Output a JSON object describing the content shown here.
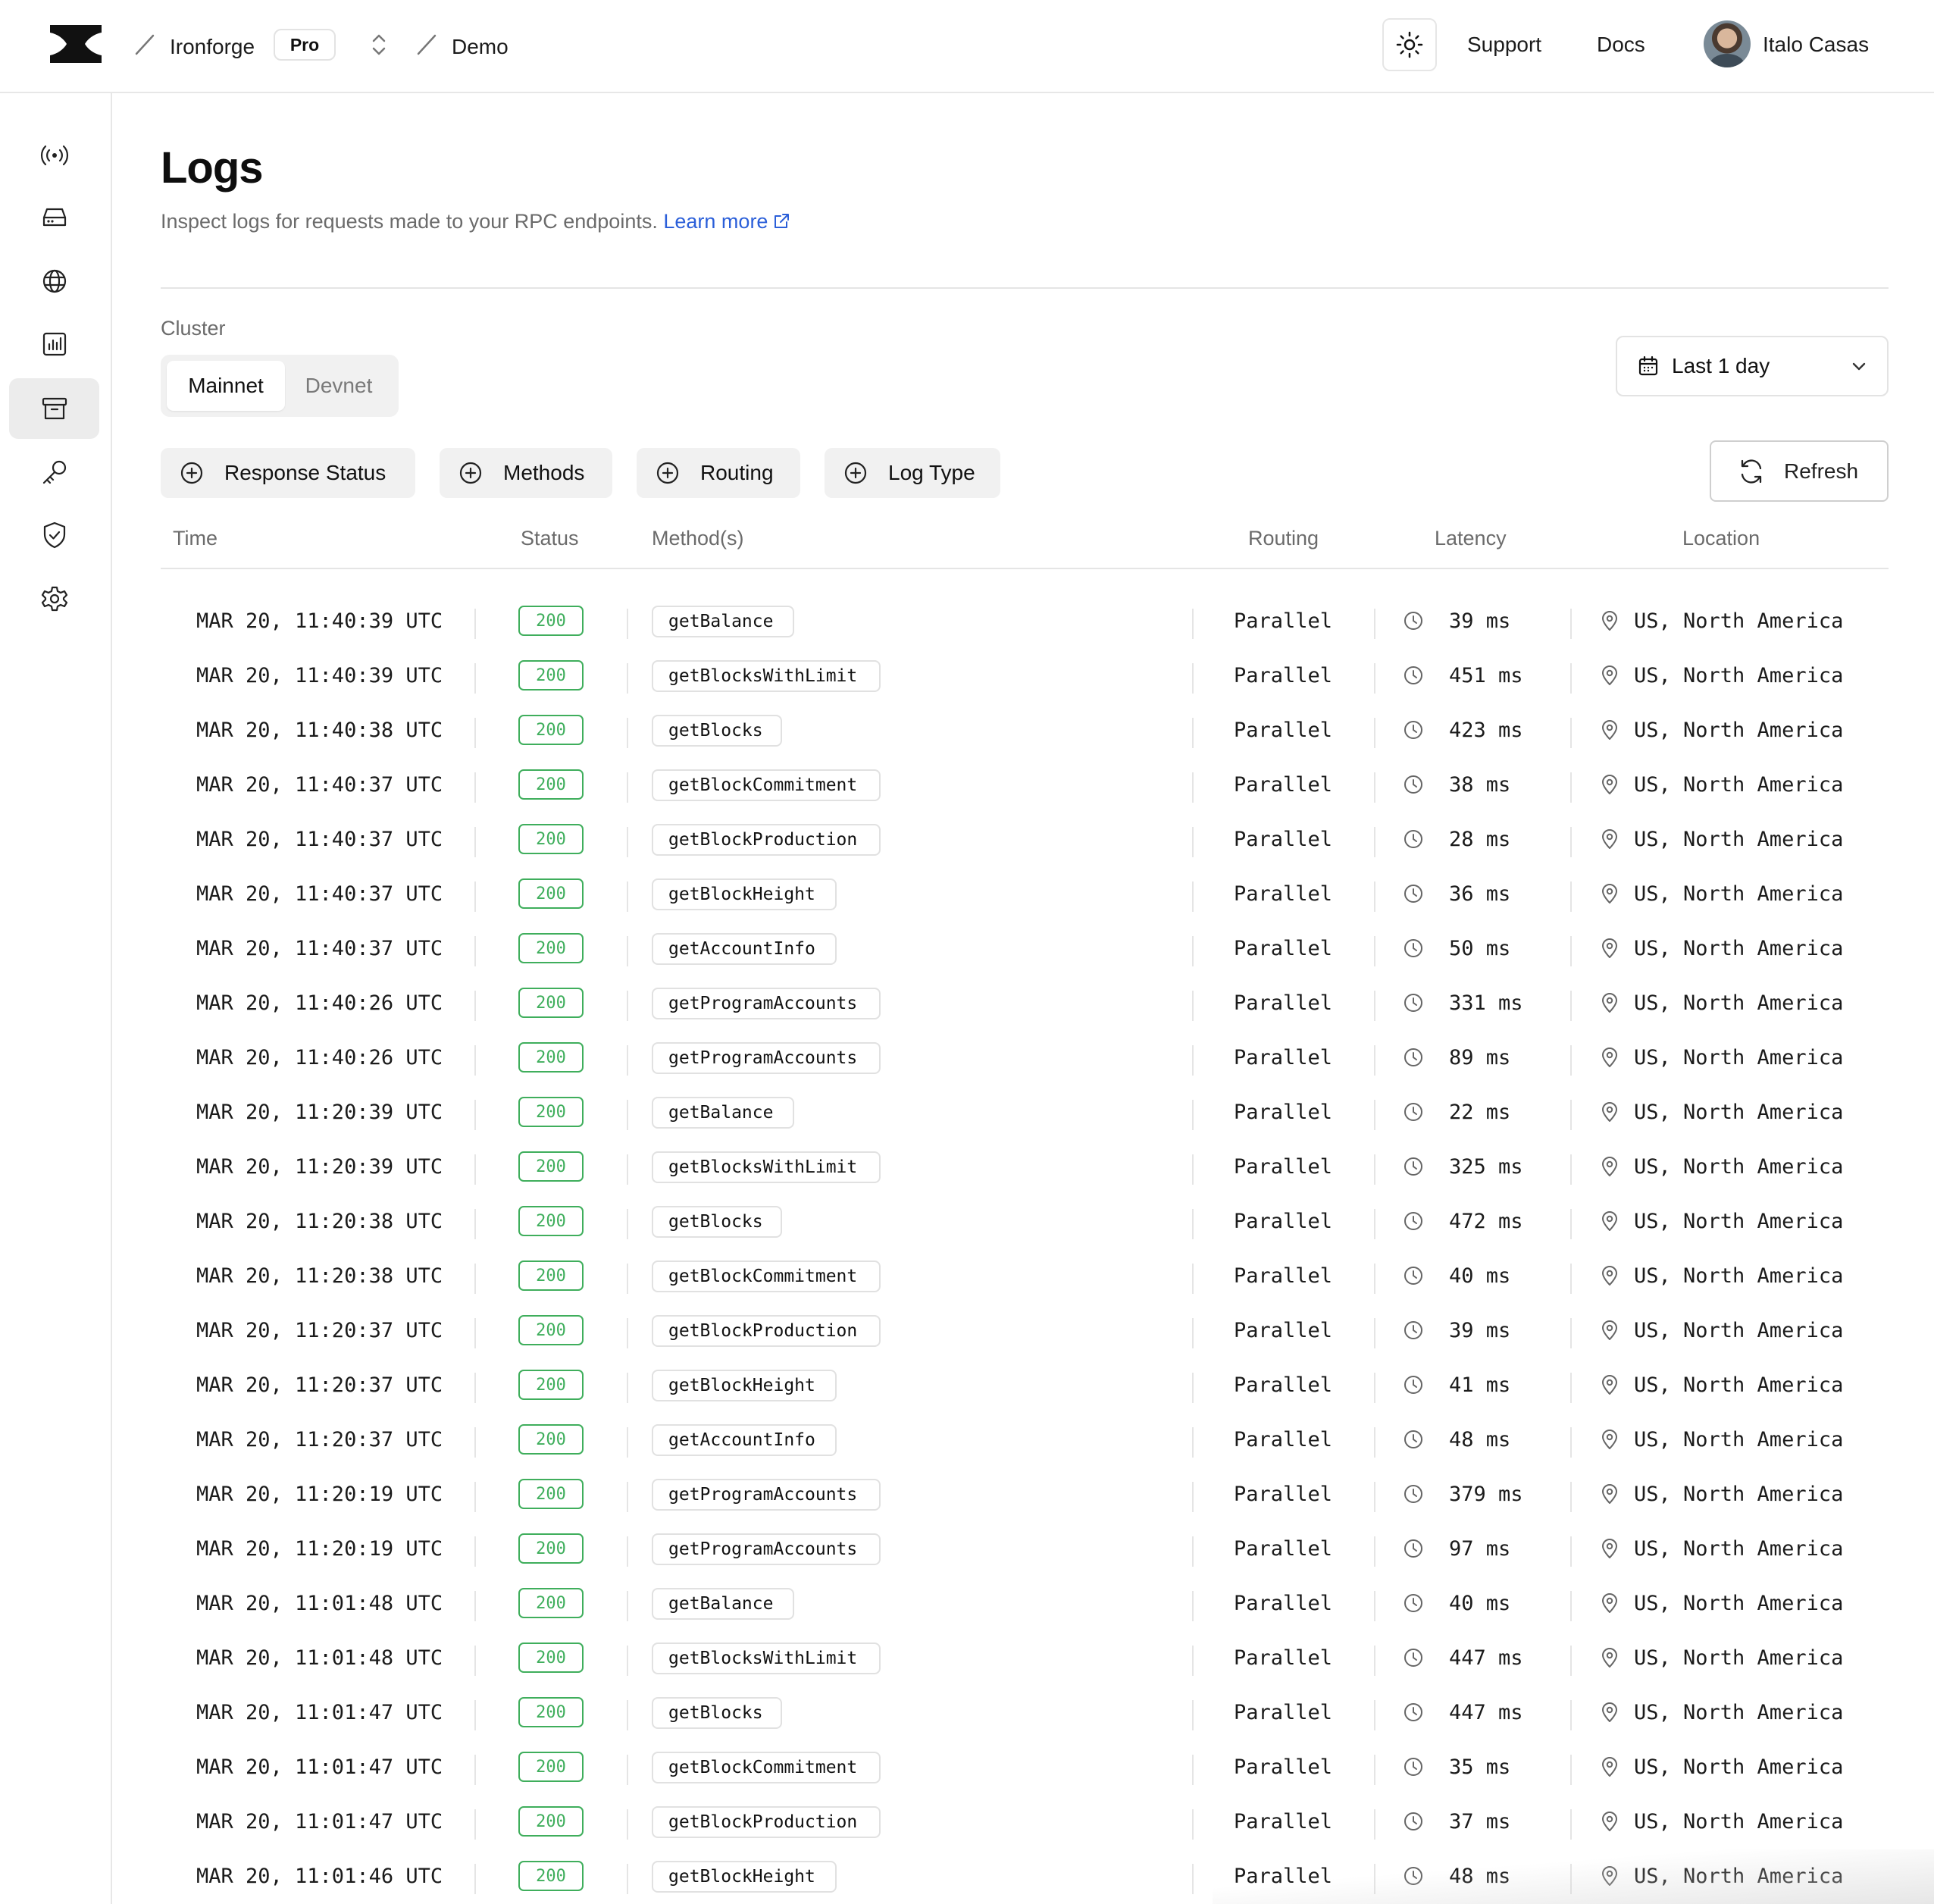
{
  "header": {
    "org": "Ironforge",
    "plan_badge": "Pro",
    "project": "Demo",
    "support_label": "Support",
    "docs_label": "Docs",
    "user_name": "Italo Casas"
  },
  "sidebar": {
    "items": [
      {
        "icon": "broadcast-icon"
      },
      {
        "icon": "server-icon"
      },
      {
        "icon": "globe-icon"
      },
      {
        "icon": "bar-chart-icon"
      },
      {
        "icon": "archive-icon",
        "active": true
      },
      {
        "icon": "key-icon"
      },
      {
        "icon": "shield-check-icon"
      },
      {
        "icon": "gear-icon"
      }
    ]
  },
  "page": {
    "title": "Logs",
    "subtitle": "Inspect logs for requests made to your RPC endpoints.",
    "learn_more": "Learn more",
    "cluster_label": "Cluster",
    "cluster_options": [
      "Mainnet",
      "Devnet"
    ],
    "cluster_selected": "Mainnet",
    "time_range": "Last 1 day",
    "refresh_label": "Refresh"
  },
  "filters": [
    "Response Status",
    "Methods",
    "Routing",
    "Log Type"
  ],
  "table": {
    "columns": [
      "Time",
      "Status",
      "Method(s)",
      "Routing",
      "Latency",
      "Location"
    ],
    "rows": [
      {
        "time": "MAR 20, 11:40:39 UTC",
        "status": "200",
        "method": "getBalance",
        "routing": "Parallel",
        "latency": "39 ms",
        "location": "US, North America"
      },
      {
        "time": "MAR 20, 11:40:39 UTC",
        "status": "200",
        "method": "getBlocksWithLimit",
        "routing": "Parallel",
        "latency": "451 ms",
        "location": "US, North America"
      },
      {
        "time": "MAR 20, 11:40:38 UTC",
        "status": "200",
        "method": "getBlocks",
        "routing": "Parallel",
        "latency": "423 ms",
        "location": "US, North America"
      },
      {
        "time": "MAR 20, 11:40:37 UTC",
        "status": "200",
        "method": "getBlockCommitment",
        "routing": "Parallel",
        "latency": "38 ms",
        "location": "US, North America"
      },
      {
        "time": "MAR 20, 11:40:37 UTC",
        "status": "200",
        "method": "getBlockProduction",
        "routing": "Parallel",
        "latency": "28 ms",
        "location": "US, North America"
      },
      {
        "time": "MAR 20, 11:40:37 UTC",
        "status": "200",
        "method": "getBlockHeight",
        "routing": "Parallel",
        "latency": "36 ms",
        "location": "US, North America"
      },
      {
        "time": "MAR 20, 11:40:37 UTC",
        "status": "200",
        "method": "getAccountInfo",
        "routing": "Parallel",
        "latency": "50 ms",
        "location": "US, North America"
      },
      {
        "time": "MAR 20, 11:40:26 UTC",
        "status": "200",
        "method": "getProgramAccounts",
        "routing": "Parallel",
        "latency": "331 ms",
        "location": "US, North America"
      },
      {
        "time": "MAR 20, 11:40:26 UTC",
        "status": "200",
        "method": "getProgramAccounts",
        "routing": "Parallel",
        "latency": "89 ms",
        "location": "US, North America"
      },
      {
        "time": "MAR 20, 11:20:39 UTC",
        "status": "200",
        "method": "getBalance",
        "routing": "Parallel",
        "latency": "22 ms",
        "location": "US, North America"
      },
      {
        "time": "MAR 20, 11:20:39 UTC",
        "status": "200",
        "method": "getBlocksWithLimit",
        "routing": "Parallel",
        "latency": "325 ms",
        "location": "US, North America"
      },
      {
        "time": "MAR 20, 11:20:38 UTC",
        "status": "200",
        "method": "getBlocks",
        "routing": "Parallel",
        "latency": "472 ms",
        "location": "US, North America"
      },
      {
        "time": "MAR 20, 11:20:38 UTC",
        "status": "200",
        "method": "getBlockCommitment",
        "routing": "Parallel",
        "latency": "40 ms",
        "location": "US, North America"
      },
      {
        "time": "MAR 20, 11:20:37 UTC",
        "status": "200",
        "method": "getBlockProduction",
        "routing": "Parallel",
        "latency": "39 ms",
        "location": "US, North America"
      },
      {
        "time": "MAR 20, 11:20:37 UTC",
        "status": "200",
        "method": "getBlockHeight",
        "routing": "Parallel",
        "latency": "41 ms",
        "location": "US, North America"
      },
      {
        "time": "MAR 20, 11:20:37 UTC",
        "status": "200",
        "method": "getAccountInfo",
        "routing": "Parallel",
        "latency": "48 ms",
        "location": "US, North America"
      },
      {
        "time": "MAR 20, 11:20:19 UTC",
        "status": "200",
        "method": "getProgramAccounts",
        "routing": "Parallel",
        "latency": "379 ms",
        "location": "US, North America"
      },
      {
        "time": "MAR 20, 11:20:19 UTC",
        "status": "200",
        "method": "getProgramAccounts",
        "routing": "Parallel",
        "latency": "97 ms",
        "location": "US, North America"
      },
      {
        "time": "MAR 20, 11:01:48 UTC",
        "status": "200",
        "method": "getBalance",
        "routing": "Parallel",
        "latency": "40 ms",
        "location": "US, North America"
      },
      {
        "time": "MAR 20, 11:01:48 UTC",
        "status": "200",
        "method": "getBlocksWithLimit",
        "routing": "Parallel",
        "latency": "447 ms",
        "location": "US, North America"
      },
      {
        "time": "MAR 20, 11:01:47 UTC",
        "status": "200",
        "method": "getBlocks",
        "routing": "Parallel",
        "latency": "447 ms",
        "location": "US, North America"
      },
      {
        "time": "MAR 20, 11:01:47 UTC",
        "status": "200",
        "method": "getBlockCommitment",
        "routing": "Parallel",
        "latency": "35 ms",
        "location": "US, North America"
      },
      {
        "time": "MAR 20, 11:01:47 UTC",
        "status": "200",
        "method": "getBlockProduction",
        "routing": "Parallel",
        "latency": "37 ms",
        "location": "US, North America"
      },
      {
        "time": "MAR 20, 11:01:46 UTC",
        "status": "200",
        "method": "getBlockHeight",
        "routing": "Parallel",
        "latency": "48 ms",
        "location": "US, North America"
      }
    ]
  },
  "colors": {
    "success": "#3fae5c",
    "link": "#2b5fd9",
    "muted": "#6b6b6b"
  }
}
